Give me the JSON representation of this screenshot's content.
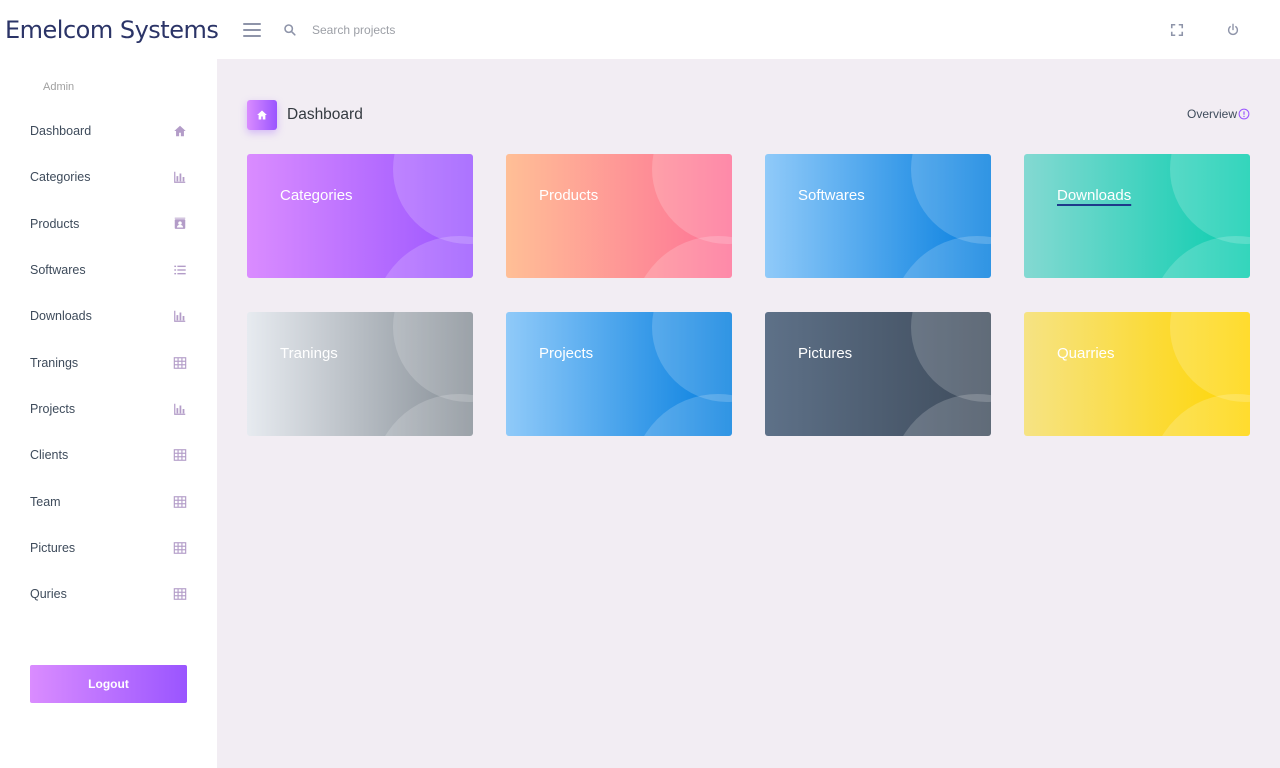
{
  "brand": {
    "name": "Emelcom Systems"
  },
  "search": {
    "placeholder": "Search projects"
  },
  "sidebar": {
    "heading": "Admin",
    "items": [
      {
        "label": "Dashboard",
        "icon": "home-icon"
      },
      {
        "label": "Categories",
        "icon": "bar-chart-icon"
      },
      {
        "label": "Products",
        "icon": "contacts-icon"
      },
      {
        "label": "Softwares",
        "icon": "list-icon"
      },
      {
        "label": "Downloads",
        "icon": "bar-chart-icon"
      },
      {
        "label": "Tranings",
        "icon": "table-icon"
      },
      {
        "label": "Projects",
        "icon": "bar-chart-icon"
      },
      {
        "label": "Clients",
        "icon": "table-icon"
      },
      {
        "label": "Team",
        "icon": "table-icon"
      },
      {
        "label": "Pictures",
        "icon": "table-icon"
      },
      {
        "label": "Quries",
        "icon": "table-icon"
      }
    ],
    "logout_label": "Logout"
  },
  "page": {
    "title": "Dashboard",
    "overview_label": "Overview"
  },
  "cards": [
    {
      "label": "Categories",
      "gradient": [
        "#da8cff",
        "#9a55ff"
      ]
    },
    {
      "label": "Products",
      "gradient": [
        "#ffbf96",
        "#fe7096"
      ]
    },
    {
      "label": "Softwares",
      "gradient": [
        "#90caf9",
        "#047edf"
      ]
    },
    {
      "label": "Downloads",
      "gradient": [
        "#84d9d2",
        "#07cdae"
      ]
    },
    {
      "label": "Tranings",
      "gradient": [
        "#e7ebf0",
        "#868e96"
      ]
    },
    {
      "label": "Projects",
      "gradient": [
        "#90caf9",
        "#047edf"
      ]
    },
    {
      "label": "Pictures",
      "gradient": [
        "#5e7188",
        "#3e4b5b"
      ]
    },
    {
      "label": "Quarries",
      "gradient": [
        "#f6e384",
        "#ffd500"
      ]
    }
  ],
  "colors": {
    "brand_text": "#2b3467",
    "accent": "#9a55ff",
    "sidebar_icon": "#b39cc8",
    "content_bg": "#f2edf3"
  }
}
